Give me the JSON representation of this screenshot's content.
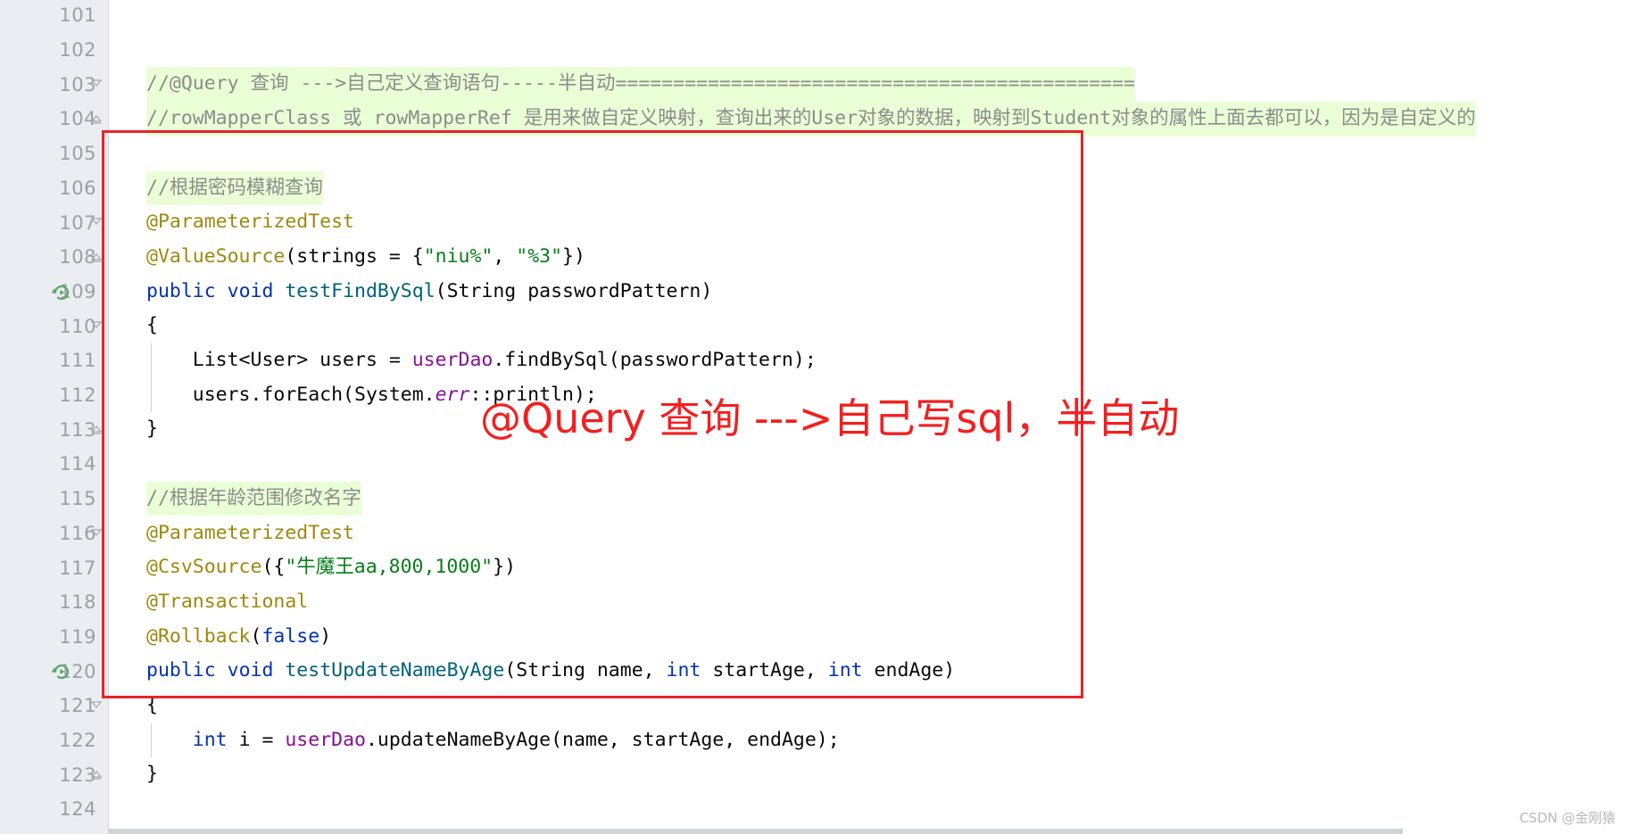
{
  "editor": {
    "line_numbers": [
      "101",
      "102",
      "103",
      "104",
      "105",
      "106",
      "107",
      "108",
      "109",
      "110",
      "111",
      "112",
      "113",
      "114",
      "115",
      "116",
      "117",
      "118",
      "119",
      "120",
      "121",
      "122",
      "123",
      "124"
    ],
    "code_lines": [
      {
        "n": "101",
        "segments": []
      },
      {
        "n": "102",
        "segments": []
      },
      {
        "n": "103",
        "highlight": true,
        "segments": [
          {
            "t": "//@Query 查询 --->自己定义查询语句-----半自动=============================================",
            "c": "cmt"
          }
        ]
      },
      {
        "n": "104",
        "highlight": true,
        "segments": [
          {
            "t": "//rowMapperClass 或 rowMapperRef 是用来做自定义映射，查询出来的User对象的数据，映射到Student对象的属性上面去都可以，因为是自定义的",
            "c": "cmt"
          }
        ]
      },
      {
        "n": "105",
        "segments": []
      },
      {
        "n": "106",
        "highlight": true,
        "segments": [
          {
            "t": "//根据密码模糊查询",
            "c": "cmt"
          }
        ]
      },
      {
        "n": "107",
        "segments": [
          {
            "t": "@ParameterizedTest",
            "c": "anno"
          }
        ]
      },
      {
        "n": "108",
        "segments": [
          {
            "t": "@ValueSource",
            "c": "anno"
          },
          {
            "t": "(strings = {",
            "c": "pln"
          },
          {
            "t": "\"niu%\"",
            "c": "str"
          },
          {
            "t": ", ",
            "c": "pln"
          },
          {
            "t": "\"%3\"",
            "c": "str"
          },
          {
            "t": "})",
            "c": "pln"
          }
        ]
      },
      {
        "n": "109",
        "run_icon": true,
        "segments": [
          {
            "t": "public",
            "c": "kw"
          },
          {
            "t": " ",
            "c": "pln"
          },
          {
            "t": "void",
            "c": "kw"
          },
          {
            "t": " ",
            "c": "pln"
          },
          {
            "t": "testFindBySql",
            "c": "mth"
          },
          {
            "t": "(String passwordPattern)",
            "c": "pln"
          }
        ]
      },
      {
        "n": "110",
        "segments": [
          {
            "t": "{",
            "c": "pln"
          }
        ]
      },
      {
        "n": "111",
        "indent": 1,
        "segments": [
          {
            "t": "    List<User> users = ",
            "c": "pln"
          },
          {
            "t": "userDao",
            "c": "fld"
          },
          {
            "t": ".findBySql(passwordPattern);",
            "c": "pln"
          }
        ]
      },
      {
        "n": "112",
        "indent": 1,
        "segments": [
          {
            "t": "    users.forEach(System.",
            "c": "pln"
          },
          {
            "t": "err",
            "c": "fldi"
          },
          {
            "t": "::println);",
            "c": "pln"
          }
        ]
      },
      {
        "n": "113",
        "segments": [
          {
            "t": "}",
            "c": "pln"
          }
        ]
      },
      {
        "n": "114",
        "segments": []
      },
      {
        "n": "115",
        "highlight": true,
        "segments": [
          {
            "t": "//根据年龄范围修改名字",
            "c": "cmt"
          }
        ]
      },
      {
        "n": "116",
        "segments": [
          {
            "t": "@ParameterizedTest",
            "c": "anno"
          }
        ]
      },
      {
        "n": "117",
        "segments": [
          {
            "t": "@CsvSource",
            "c": "anno"
          },
          {
            "t": "({",
            "c": "pln"
          },
          {
            "t": "\"牛魔王aa,800,1000\"",
            "c": "str"
          },
          {
            "t": "})",
            "c": "pln"
          }
        ]
      },
      {
        "n": "118",
        "segments": [
          {
            "t": "@Transactional",
            "c": "anno"
          }
        ]
      },
      {
        "n": "119",
        "segments": [
          {
            "t": "@Rollback",
            "c": "anno"
          },
          {
            "t": "(",
            "c": "pln"
          },
          {
            "t": "false",
            "c": "kw"
          },
          {
            "t": ")",
            "c": "pln"
          }
        ]
      },
      {
        "n": "120",
        "run_icon": true,
        "segments": [
          {
            "t": "public",
            "c": "kw"
          },
          {
            "t": " ",
            "c": "pln"
          },
          {
            "t": "void",
            "c": "kw"
          },
          {
            "t": " ",
            "c": "pln"
          },
          {
            "t": "testUpdateNameByAge",
            "c": "mth"
          },
          {
            "t": "(String name, ",
            "c": "pln"
          },
          {
            "t": "int",
            "c": "kw"
          },
          {
            "t": " startAge, ",
            "c": "pln"
          },
          {
            "t": "int",
            "c": "kw"
          },
          {
            "t": " endAge)",
            "c": "pln"
          }
        ]
      },
      {
        "n": "121",
        "segments": [
          {
            "t": "{",
            "c": "pln"
          }
        ]
      },
      {
        "n": "122",
        "indent": 1,
        "segments": [
          {
            "t": "    ",
            "c": "pln"
          },
          {
            "t": "int",
            "c": "kw"
          },
          {
            "t": " i = ",
            "c": "pln"
          },
          {
            "t": "userDao",
            "c": "fld"
          },
          {
            "t": ".updateNameByAge(name, startAge, endAge);",
            "c": "pln"
          }
        ]
      },
      {
        "n": "123",
        "segments": [
          {
            "t": "}",
            "c": "pln"
          }
        ]
      },
      {
        "n": "124",
        "segments": []
      }
    ],
    "fold_markers": [
      {
        "line": "103",
        "type": "fold-collapse-start"
      },
      {
        "line": "104",
        "type": "fold-collapse-end"
      },
      {
        "line": "107",
        "type": "fold-collapse-start"
      },
      {
        "line": "108",
        "type": "fold-collapse-end"
      },
      {
        "line": "110",
        "type": "fold-block"
      },
      {
        "line": "113",
        "type": "fold-block-end"
      },
      {
        "line": "116",
        "type": "fold-collapse-start"
      },
      {
        "line": "121",
        "type": "fold-block"
      },
      {
        "line": "123",
        "type": "fold-block-end"
      }
    ],
    "run_icons": [
      {
        "line": "109",
        "name": "run-test-icon"
      },
      {
        "line": "120",
        "name": "run-test-icon"
      }
    ]
  },
  "annotations": {
    "red_box_label": "highlighted-code-region",
    "red_text": "@Query 查询 --->自己写sql，半自动",
    "red_color": "#f21f20",
    "box_color": "#e8232a"
  },
  "watermark": {
    "text": "CSDN @金刚猿"
  },
  "colors": {
    "gutter_bg": "#eaeef2",
    "line_number": "#9a9fa6",
    "keyword": "#0033b3",
    "annotation": "#9e880d",
    "string": "#067d17",
    "field": "#871094",
    "method": "#00627a",
    "comment": "#8c8c8c",
    "comment_highlight": "#eaffd6",
    "editor_bg": "#ffffff"
  }
}
